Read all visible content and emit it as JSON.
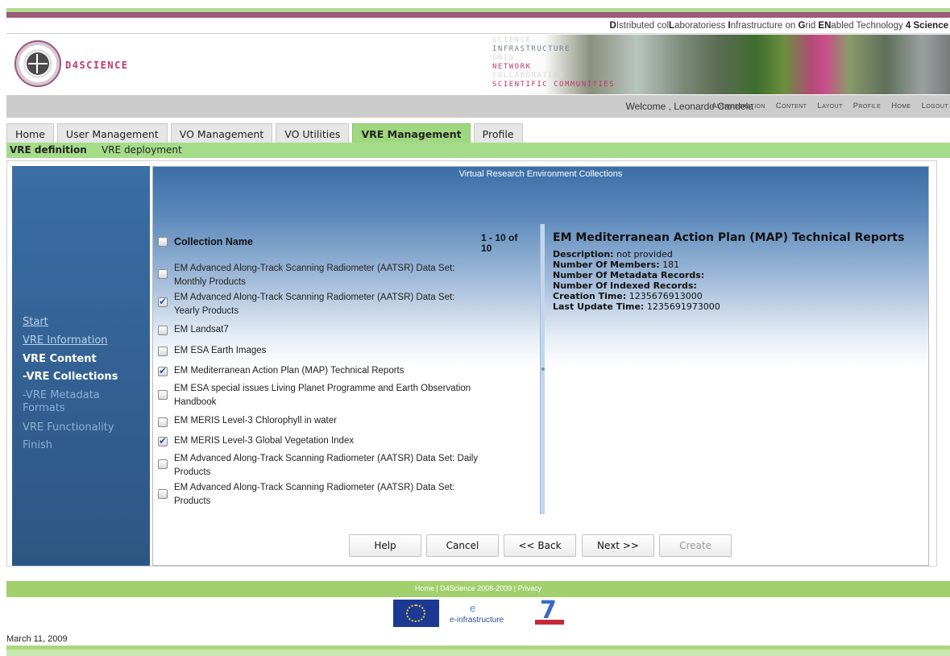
{
  "header": {
    "tagline_parts": [
      {
        "bold": "D",
        "rest": "Istributed col"
      },
      {
        "bold": "L",
        "rest": "aboratoriess "
      },
      {
        "bold": "I",
        "rest": "nfrastructure on "
      },
      {
        "bold": "G",
        "rest": "rid "
      },
      {
        "bold": "EN",
        "rest": "abled "
      },
      {
        "bold": "",
        "rest": "Technology "
      },
      {
        "bold": "4 Science",
        "rest": ""
      }
    ],
    "brand": "D4SCIENCE",
    "banner_words": [
      "SCIENCE",
      "INFRASTRUCTURE",
      "GRID",
      "NETWORK",
      "COLLABORATION",
      "SCIENTIFIC COMMUNITIES"
    ]
  },
  "userbar": {
    "welcome": "Welcome , Leonardo Candela",
    "links": [
      "Administration",
      "Content",
      "Layout",
      "Profile",
      "Home",
      "Logout"
    ]
  },
  "tabs": [
    "Home",
    "User Management",
    "VO Management",
    "VO Utilities",
    "VRE Management",
    "Profile"
  ],
  "active_tab": "VRE Management",
  "subnav": [
    "VRE definition",
    "VRE deployment"
  ],
  "left_nav": [
    "Start",
    "VRE Information",
    "VRE Content",
    "-VRE Collections",
    "-VRE Metadata Formats",
    "VRE Functionality",
    "Finish"
  ],
  "main": {
    "title": "Virtual Research Environment Collections",
    "column_header": "Collection Name",
    "paging": "1 - 10 of 10",
    "collections": [
      {
        "name": "EM Advanced Along-Track Scanning Radiometer (AATSR) Data Set: Monthly Products",
        "checked": false
      },
      {
        "name": "EM Advanced Along-Track Scanning Radiometer (AATSR) Data Set: Yearly Products",
        "checked": true
      },
      {
        "name": "EM Landsat7",
        "checked": false
      },
      {
        "name": "EM ESA Earth Images",
        "checked": false
      },
      {
        "name": "EM Mediterranean Action Plan (MAP) Technical Reports",
        "checked": true
      },
      {
        "name": "EM ESA special issues Living Planet Programme and Earth Observation Handbook",
        "checked": false
      },
      {
        "name": "EM MERIS Level-3 Chlorophyll in water",
        "checked": false
      },
      {
        "name": "EM MERIS Level-3 Global Vegetation Index",
        "checked": true
      },
      {
        "name": "EM Advanced Along-Track Scanning Radiometer (AATSR) Data Set: Daily Products",
        "checked": false
      },
      {
        "name": "EM Advanced Along-Track Scanning Radiometer (AATSR) Data Set: Products",
        "checked": false
      }
    ],
    "detail": {
      "title": "EM Mediterranean Action Plan (MAP) Technical Reports",
      "description_label": "Description:",
      "description_value": "not provided",
      "members_label": "Number Of Members:",
      "members_value": "181",
      "metadata_label": "Number Of Metadata Records:",
      "metadata_value": "",
      "indexed_label": "Number Of Indexed Records:",
      "indexed_value": "",
      "creation_label": "Creation Time:",
      "creation_value": "1235676913000",
      "update_label": "Last Update Time:",
      "update_value": "1235691973000"
    },
    "buttons": {
      "help": "Help",
      "cancel": "Cancel",
      "back": "<< Back",
      "next": "Next >>",
      "create": "Create"
    }
  },
  "footer": {
    "links": "Home | D4Science 2008-2009 | Privacy",
    "einfra": "e-infrastructure",
    "date": "March 11, 2009"
  },
  "colors": {
    "green_accent": "#a5dc8a",
    "blue_panel": "#3a6ea5",
    "brand_pink": "#c0386b",
    "purple_bar": "#9b5a7a"
  }
}
